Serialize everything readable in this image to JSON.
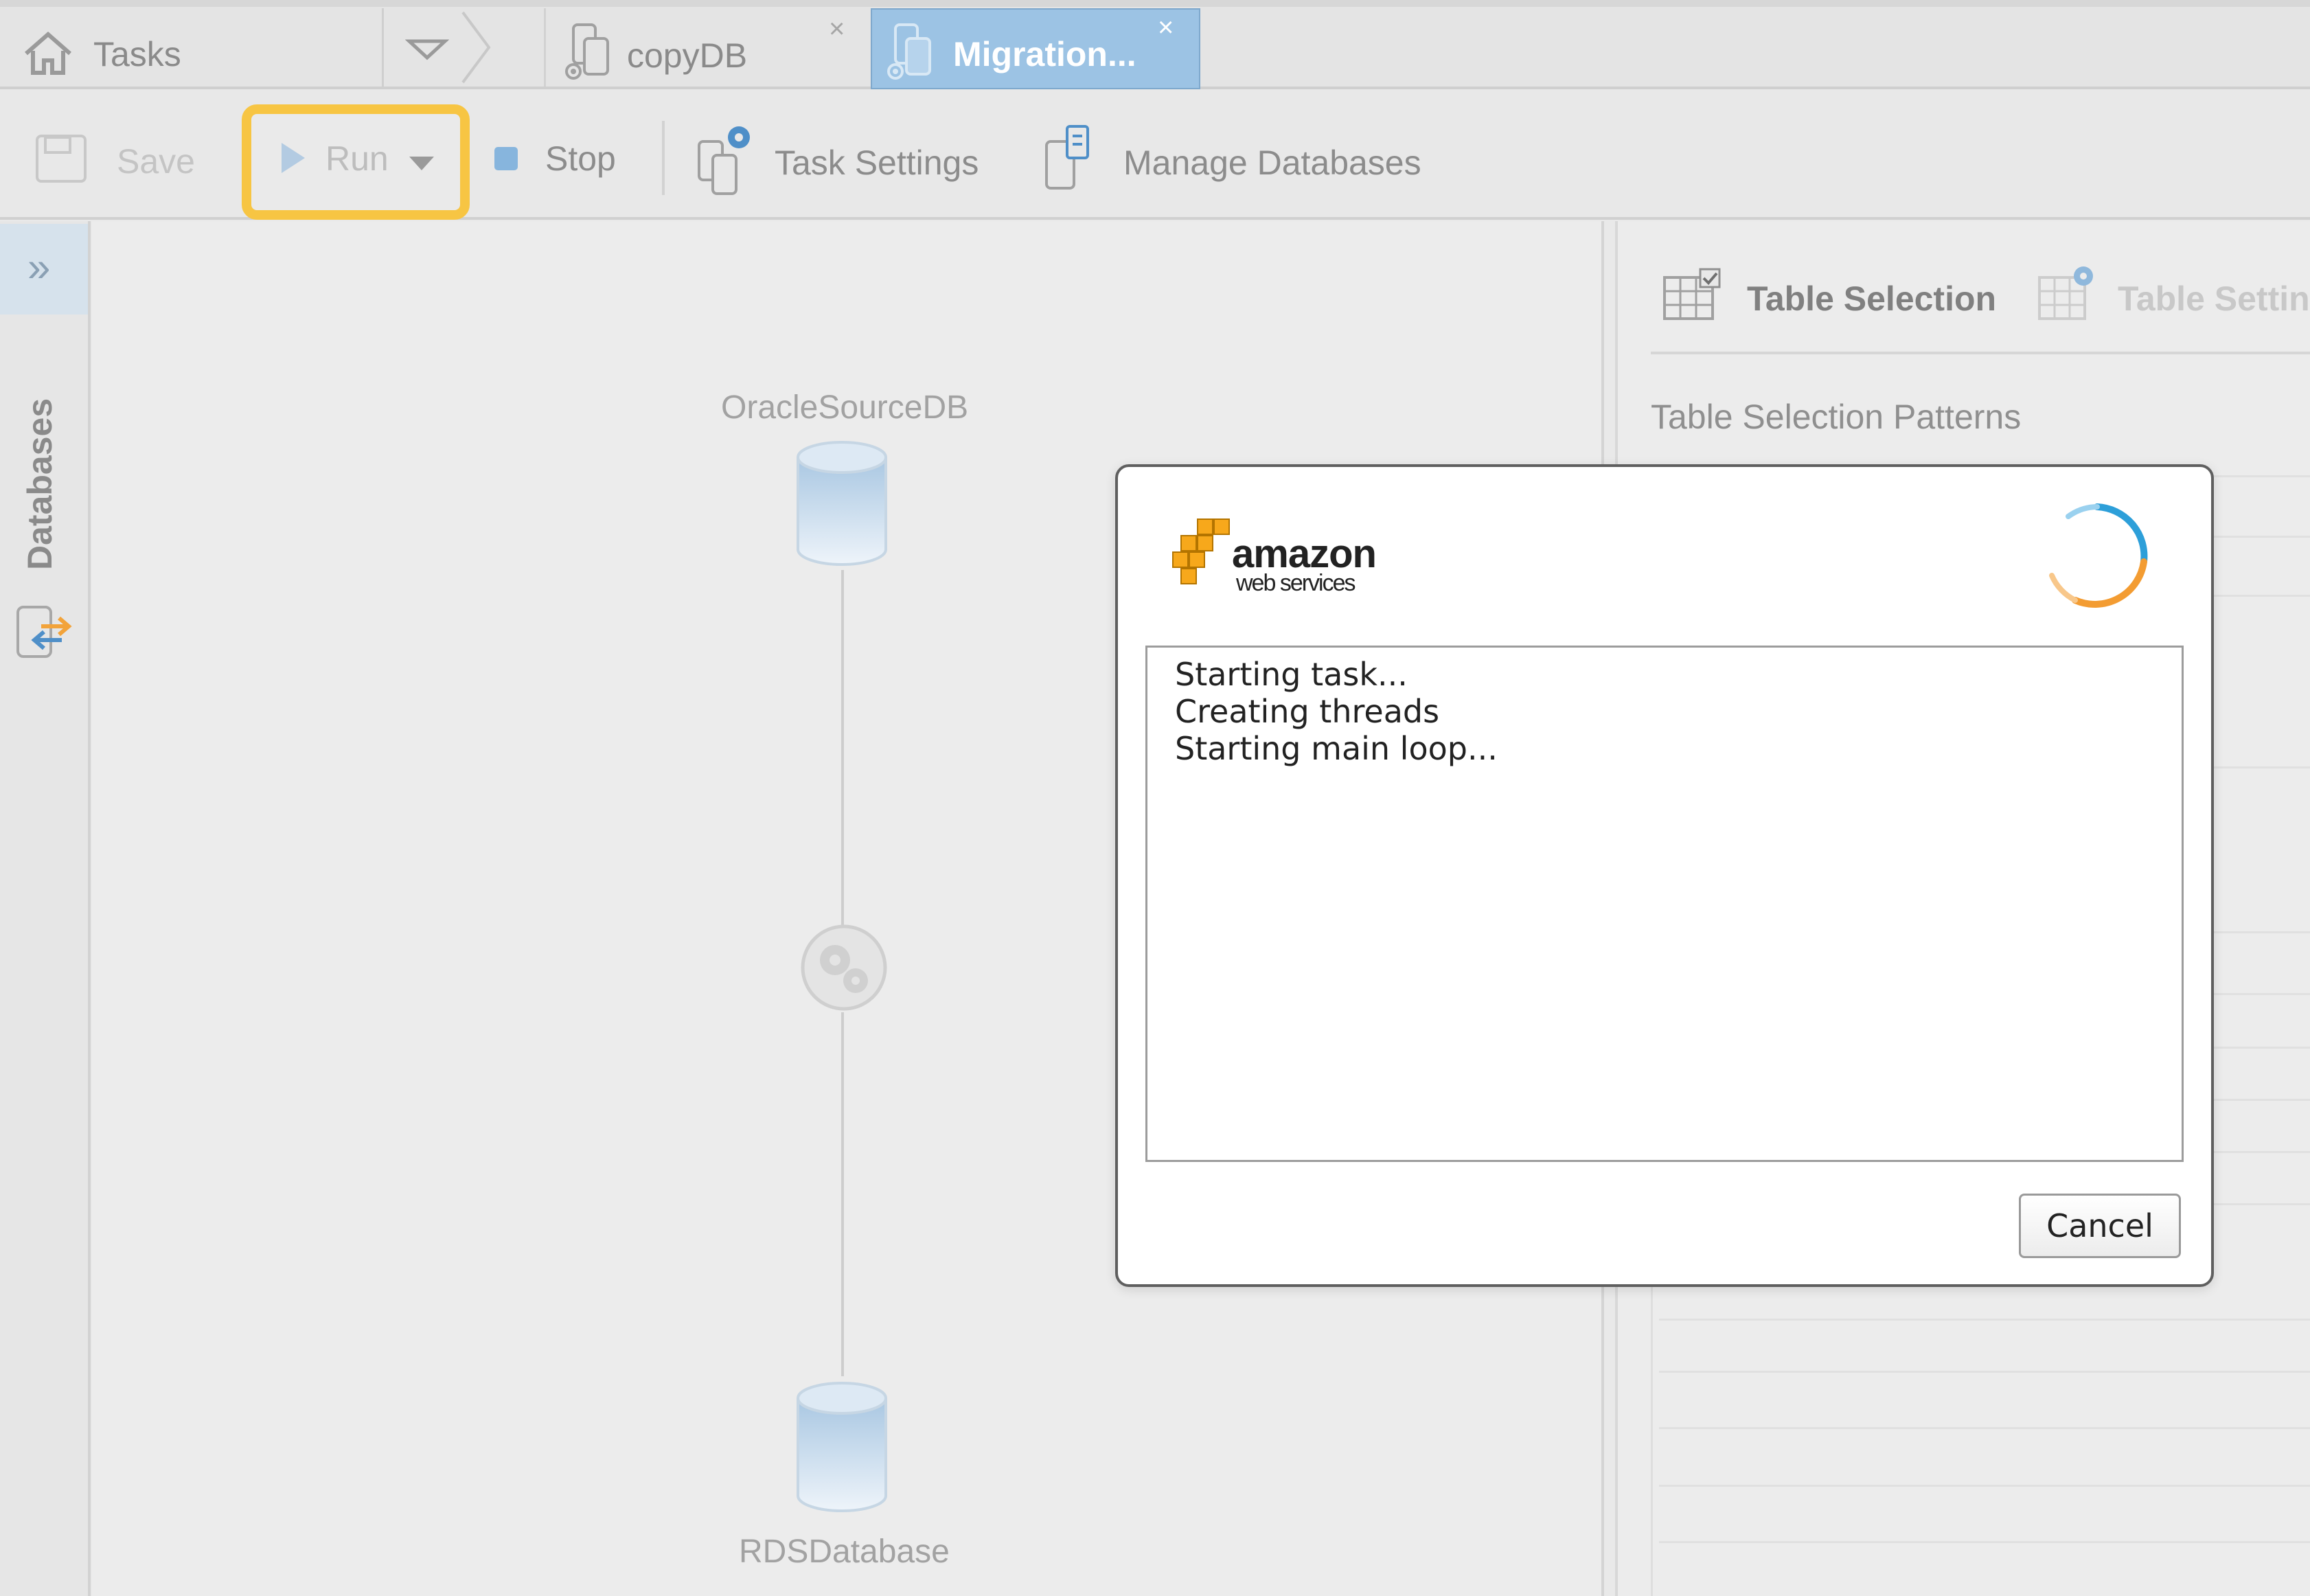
{
  "tabs": {
    "home": "Tasks",
    "copy": "copyDB",
    "active": "Migration...",
    "close_glyph": "×"
  },
  "toolbar": {
    "save": "Save",
    "run": "Run",
    "stop": "Stop",
    "task_settings": "Task Settings",
    "manage_databases": "Manage Databases"
  },
  "sidebar": {
    "toggle_glyph": "»",
    "databases_label": "Databases"
  },
  "canvas": {
    "source_db": "OracleSourceDB",
    "target_db": "RDSDatabase"
  },
  "right_panel": {
    "tab_table_selection": "Table Selection",
    "tab_table_settings": "Table Settings",
    "section_title": "Table Selection Patterns"
  },
  "dialog": {
    "logo_wordmark": "amazon",
    "logo_subtext": "web services",
    "log_lines": [
      "Starting task...",
      "Creating threads",
      "Starting main loop..."
    ],
    "cancel": "Cancel"
  },
  "colors": {
    "highlight": "#f7c543",
    "active_tab": "#9cc3e4",
    "aws_orange": "#f7a81b",
    "spinner_blue": "#2d9fd9",
    "spinner_orange": "#f39c32"
  }
}
